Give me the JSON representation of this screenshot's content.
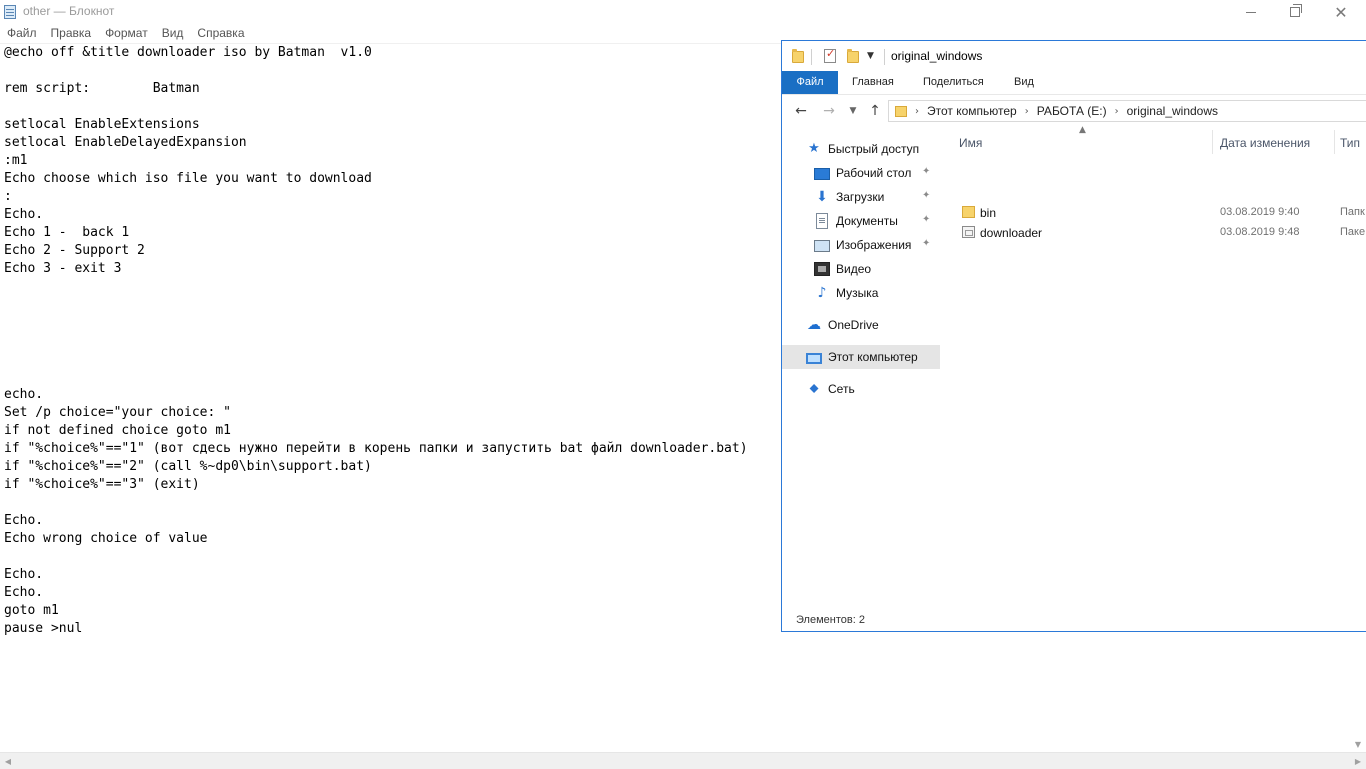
{
  "notepad": {
    "title": "other — Блокнот",
    "menu": [
      "Файл",
      "Правка",
      "Формат",
      "Вид",
      "Справка"
    ],
    "lines": [
      "@echo off &title downloader iso by Batman  v1.0",
      "",
      "rem script:        Batman",
      "",
      "setlocal EnableExtensions",
      "setlocal EnableDelayedExpansion",
      ":m1",
      "Echo choose which iso file you want to download",
      ":",
      "Echo.",
      "Echo 1 -  back 1",
      "Echo 2 - Support 2",
      "Echo 3 - exit 3",
      "",
      "",
      "",
      "",
      "",
      "",
      "echo.",
      "Set /p choice=\"your choice: \"",
      "if not defined choice goto m1",
      "if \"%choice%\"==\"1\" (вот сдесь нужно перейти в корень папки и запустить bat файл downloader.bat)",
      "if \"%choice%\"==\"2\" (call %~dp0\\bin\\support.bat)",
      "if \"%choice%\"==\"3\" (exit)",
      "",
      "Echo.",
      "Echo wrong choice of value",
      "",
      "Echo.",
      "Echo.",
      "goto m1",
      "pause >nul"
    ]
  },
  "explorer": {
    "title": "original_windows",
    "ribbon": {
      "file": "Файл",
      "home": "Главная",
      "share": "Поделиться",
      "view": "Вид"
    },
    "breadcrumb": [
      "Этот компьютер",
      "РАБОТА (E:)",
      "original_windows"
    ],
    "nav": [
      {
        "label": "Быстрый доступ",
        "icon": "star-icon",
        "indent": 0,
        "pinned": false
      },
      {
        "label": "Рабочий стол",
        "icon": "desktop-icon",
        "indent": 1,
        "pinned": true
      },
      {
        "label": "Загрузки",
        "icon": "downloads-icon",
        "indent": 1,
        "pinned": true
      },
      {
        "label": "Документы",
        "icon": "documents-icon",
        "indent": 1,
        "pinned": true
      },
      {
        "label": "Изображения",
        "icon": "pictures-icon",
        "indent": 1,
        "pinned": true
      },
      {
        "label": "Видео",
        "icon": "video-icon",
        "indent": 1,
        "pinned": false
      },
      {
        "label": "Музыка",
        "icon": "music-icon",
        "indent": 1,
        "pinned": false
      },
      {
        "label": "OneDrive",
        "icon": "cloud-icon",
        "indent": 0,
        "pinned": false
      },
      {
        "label": "Этот компьютер",
        "icon": "computer-icon",
        "indent": 0,
        "pinned": false,
        "selected": true
      },
      {
        "label": "Сеть",
        "icon": "network-icon",
        "indent": 0,
        "pinned": false
      }
    ],
    "columns": {
      "name": "Имя",
      "date": "Дата изменения",
      "type": "Тип"
    },
    "files": [
      {
        "name": "bin",
        "date": "03.08.2019 9:40",
        "type": "Папк",
        "icon": "folder-icon"
      },
      {
        "name": "downloader",
        "date": "03.08.2019 9:48",
        "type": "Паке",
        "icon": "batch-file-icon"
      }
    ],
    "status": "Элементов: 2"
  },
  "colors": {
    "accent": "#1a6fc4",
    "window_border": "#2b79d8",
    "selected_nav": "#e5e5e5"
  }
}
